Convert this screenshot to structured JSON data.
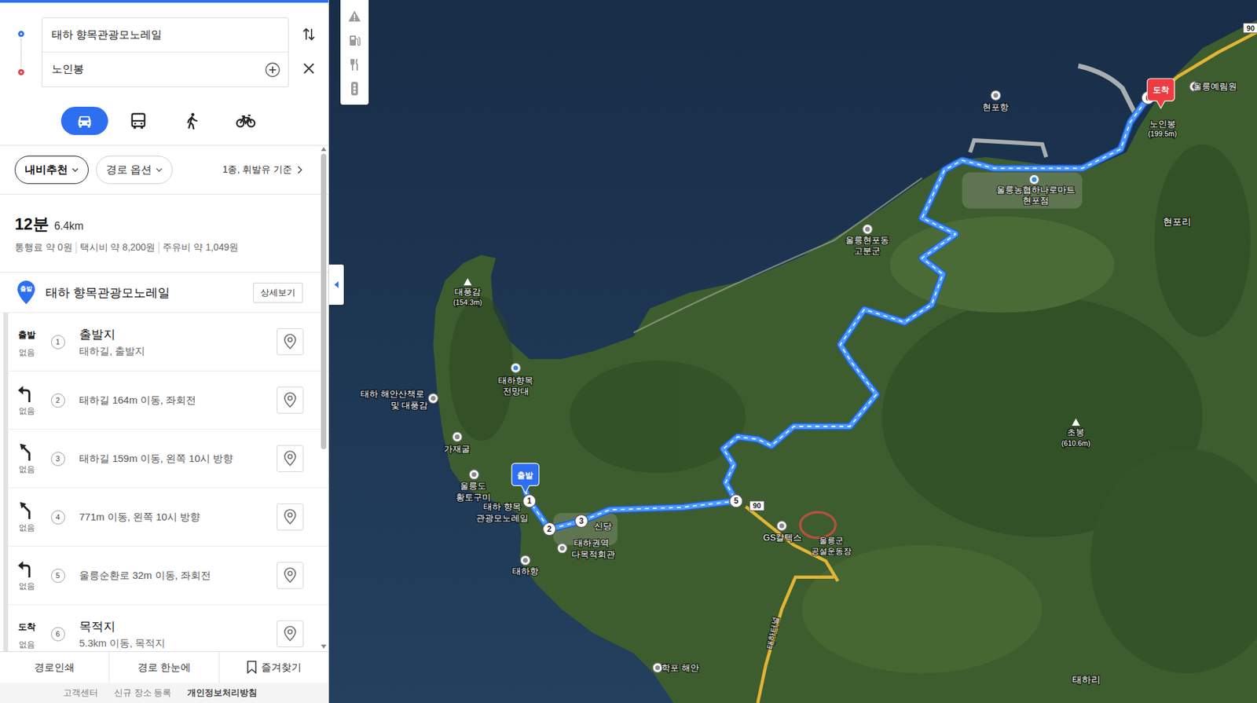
{
  "search": {
    "origin": "태하 향목관광모노레일",
    "destination": "노인봉"
  },
  "modes": [
    {
      "kind": "car",
      "selected": true
    },
    {
      "kind": "bus",
      "selected": false
    },
    {
      "kind": "walk",
      "selected": false
    },
    {
      "kind": "bike",
      "selected": false
    }
  ],
  "options": {
    "recommend": {
      "label": "내비추천",
      "selected": true
    },
    "route_option": {
      "label": "경로 옵션",
      "selected": false
    },
    "fuel": "1종, 휘발유 기준"
  },
  "summary": {
    "time": "12분",
    "distance": "6.4km",
    "costs": [
      "통행료 약 0원",
      "택시비 약 8,200원",
      "주유비 약 1,049원"
    ]
  },
  "start": {
    "badge": "출발",
    "name": "태하 향목관광모노레일",
    "button": "상세보기"
  },
  "steps": [
    {
      "num": "1",
      "kind": "start",
      "icon_text": "출발",
      "traffic": "없음",
      "title": "출발지",
      "detail": "태하길, 출발지"
    },
    {
      "num": "2",
      "kind": "left",
      "icon_text": "",
      "traffic": "없음",
      "title": "",
      "detail": "태하길 164m 이동, 좌회전"
    },
    {
      "num": "3",
      "kind": "slight-left",
      "icon_text": "",
      "traffic": "없음",
      "title": "",
      "detail": "태하길 159m 이동, 왼쪽 10시 방향"
    },
    {
      "num": "4",
      "kind": "slight-left",
      "icon_text": "",
      "traffic": "없음",
      "title": "",
      "detail": "771m 이동, 왼쪽 10시 방향"
    },
    {
      "num": "5",
      "kind": "left",
      "icon_text": "",
      "traffic": "없음",
      "title": "",
      "detail": "울릉순환로 32m 이동, 좌회전"
    },
    {
      "num": "6",
      "kind": "end",
      "icon_text": "도착",
      "traffic": "없음",
      "title": "목적지",
      "detail": "5.3km 이동, 목적지"
    }
  ],
  "bottom_actions": [
    "경로인쇄",
    "경로 한눈에",
    "즐겨찾기"
  ],
  "footer": [
    {
      "label": "고객센터",
      "bold": false
    },
    {
      "label": "신규 장소 등록",
      "bold": false
    },
    {
      "label": "개인정보처리방침",
      "bold": true
    }
  ],
  "map": {
    "labels": [
      "대풍감",
      "(154.3m)",
      "태하향목",
      "전망대",
      "태하 해안산책로",
      "및 대풍감",
      "가재굴",
      "울릉도",
      "황토구미",
      "태하 향목",
      "관광모노레일",
      "신당",
      "태하권역",
      "다목적회관",
      "태하항",
      "GS칼텍스",
      "울릉군",
      "공설운동장",
      "학포 해안",
      "태하리",
      "초봉",
      "(610.6m)",
      "현포리",
      "현포항",
      "울릉농협하나로마트",
      "현포점",
      "울릉현포동",
      "고분군",
      "노인봉",
      "(199.5m)",
      "울릉예림원"
    ],
    "road_label": "태하터널",
    "road_numbers": [
      "90",
      "90"
    ],
    "waypoints": [
      "1",
      "2",
      "3",
      "5",
      "6"
    ],
    "start_pin": "출발",
    "end_pin": "도착"
  }
}
